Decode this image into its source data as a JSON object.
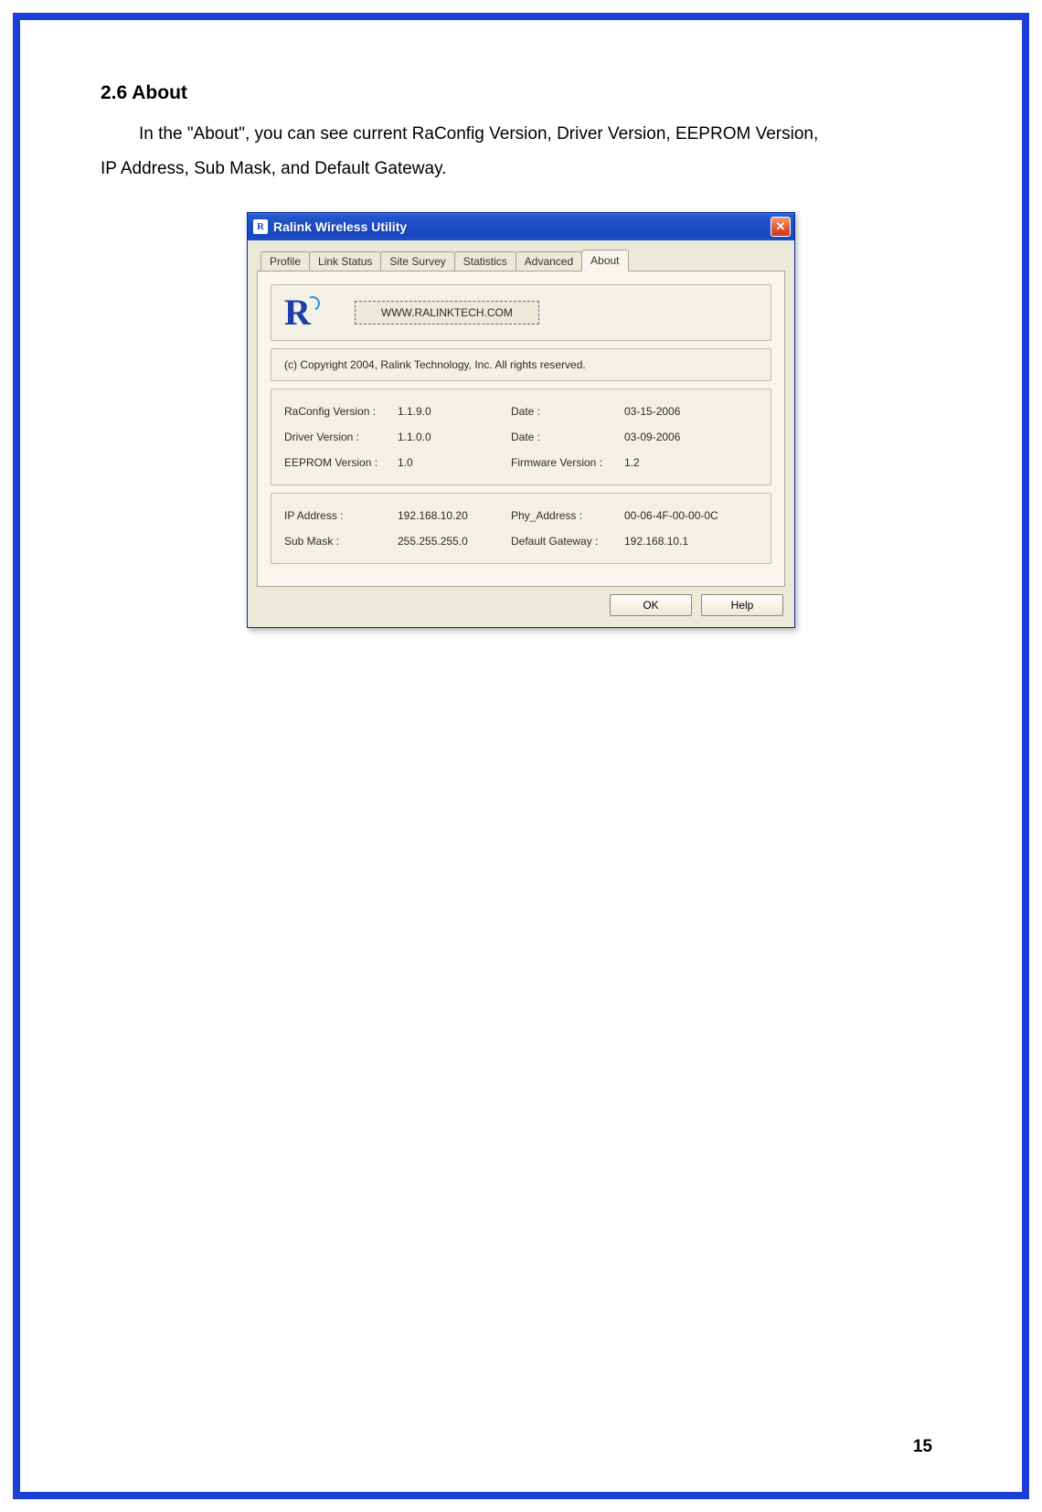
{
  "doc": {
    "heading": "2.6  About",
    "para_line1": "In the \"About\", you can see current RaConfig Version, Driver Version, EEPROM Version,",
    "para_line2": "IP Address, Sub Mask, and Default Gateway.",
    "page_number": "15"
  },
  "window": {
    "title": "Ralink Wireless Utility",
    "icon_letter": "R",
    "close_glyph": "✕",
    "tabs": {
      "t0": "Profile",
      "t1": "Link Status",
      "t2": "Site Survey",
      "t3": "Statistics",
      "t4": "Advanced",
      "t5": "About"
    },
    "link_button": "WWW.RALINKTECH.COM",
    "copyright": "(c) Copyright 2004, Ralink Technology, Inc.  All rights reserved.",
    "versions": {
      "raconfig_label": "RaConfig Version :",
      "raconfig_value": "1.1.9.0",
      "raconfig_date_label": "Date :",
      "raconfig_date_value": "03-15-2006",
      "driver_label": "Driver Version :",
      "driver_value": "1.1.0.0",
      "driver_date_label": "Date :",
      "driver_date_value": "03-09-2006",
      "eeprom_label": "EEPROM Version :",
      "eeprom_value": "1.0",
      "firmware_label": "Firmware Version :",
      "firmware_value": "1.2"
    },
    "network": {
      "ip_label": "IP Address :",
      "ip_value": "192.168.10.20",
      "phy_label": "Phy_Address :",
      "phy_value": "00-06-4F-00-00-0C",
      "mask_label": "Sub Mask :",
      "mask_value": "255.255.255.0",
      "gw_label": "Default Gateway :",
      "gw_value": "192.168.10.1"
    },
    "buttons": {
      "ok": "OK",
      "help": "Help"
    }
  }
}
